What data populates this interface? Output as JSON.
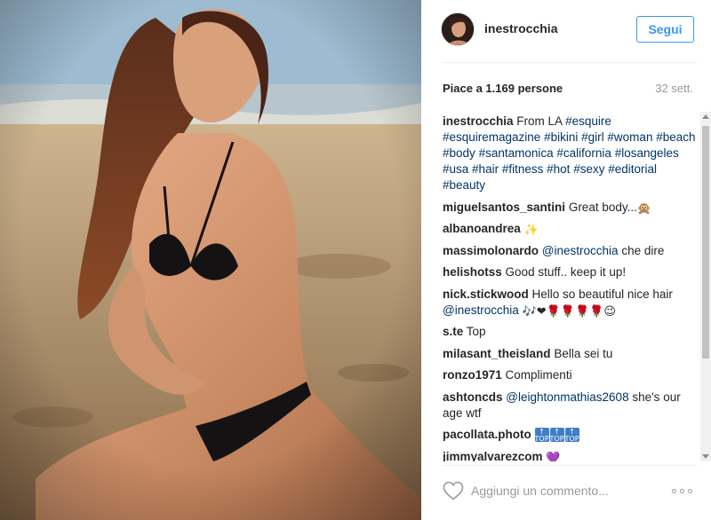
{
  "post": {
    "username": "inestrocchia",
    "follow_label": "Segui",
    "likes": "Piace a 1.169 persone",
    "age": "32 sett."
  },
  "caption": {
    "author": "inestrocchia",
    "text": "From LA",
    "hashtags": [
      "#esquire",
      "#esquiremagazine",
      "#bikini",
      "#girl",
      "#woman",
      "#beach",
      "#body",
      "#santamonica",
      "#california",
      "#losangeles",
      "#usa",
      "#hair",
      "#fitness",
      "#hot",
      "#sexy",
      "#editorial",
      "#beauty"
    ]
  },
  "comments": [
    {
      "author": "miguelsantos_santini",
      "text": "Great body...",
      "emoji": "🙊"
    },
    {
      "author": "albanoandrea",
      "text": "",
      "emoji": "✨"
    },
    {
      "author": "massimolonardo",
      "mention": "@inestrocchia",
      "text": "che dire"
    },
    {
      "author": "helishotss",
      "text": "Good stuff.. keep it up!"
    },
    {
      "author": "nick.stickwood",
      "text": "Hello so beautiful nice hair",
      "mention": "@inestrocchia",
      "emoji": "🎶❤🌹🌹🌹🌹😉"
    },
    {
      "author": "s.te",
      "text": "Top"
    },
    {
      "author": "milasant_theisland",
      "text": "Bella sei tu"
    },
    {
      "author": "ronzo1971",
      "text": "Complimenti"
    },
    {
      "author": "ashtoncds",
      "mention": "@leightonmathias2608",
      "text": "she's our age wtf"
    },
    {
      "author": "pacollata.photo",
      "text": "",
      "top_badge": "TOP"
    },
    {
      "author": "jimmyalvarezcom",
      "text": "",
      "emoji": "💜"
    }
  ],
  "footer": {
    "comment_placeholder": "Aggiungi un commento..."
  },
  "icons": {
    "like": "heart-outline-icon",
    "options": "more-options-icon"
  },
  "colors": {
    "link": "#003569",
    "follow_blue": "#3897f0",
    "muted": "#999999"
  }
}
